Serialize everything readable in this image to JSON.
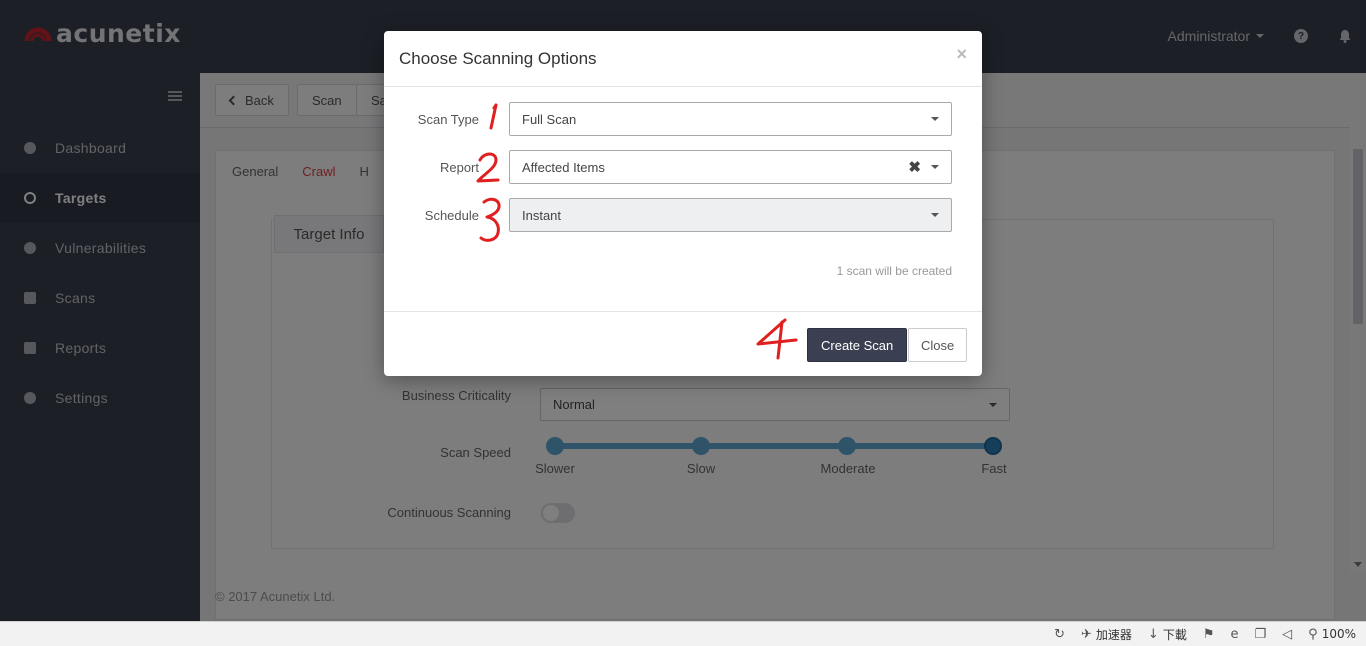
{
  "app": {
    "brand": "acunetix",
    "brand_color": "#c7262e"
  },
  "topbar": {
    "user": "Administrator",
    "help_icon": "question-circle-icon",
    "bell_icon": "bell-icon"
  },
  "sidebar": {
    "items": [
      {
        "label": "Dashboard",
        "icon": "dashboard-icon"
      },
      {
        "label": "Targets",
        "icon": "target-icon",
        "active": true
      },
      {
        "label": "Vulnerabilities",
        "icon": "bug-icon"
      },
      {
        "label": "Scans",
        "icon": "chart-icon"
      },
      {
        "label": "Reports",
        "icon": "document-icon"
      },
      {
        "label": "Settings",
        "icon": "gear-icon"
      }
    ]
  },
  "toolbar": {
    "back": "Back",
    "scan": "Scan",
    "partial": "Sa"
  },
  "tabs": [
    "General",
    "Crawl",
    "H"
  ],
  "target_form": {
    "section_tab": "Target Info",
    "business_criticality_label": "Business Criticality",
    "business_criticality_value": "Normal",
    "scan_speed_label": "Scan Speed",
    "scan_speed_options": [
      "Slower",
      "Slow",
      "Moderate",
      "Fast"
    ],
    "scan_speed_selected": "Fast",
    "continuous_label": "Continuous Scanning"
  },
  "footer": "© 2017 Acunetix Ltd.",
  "modal": {
    "title": "Choose Scanning Options",
    "close_glyph": "×",
    "scan_type_label": "Scan Type",
    "scan_type_value": "Full Scan",
    "report_label": "Report",
    "report_value": "Affected Items",
    "schedule_label": "Schedule",
    "schedule_value": "Instant",
    "scan_count": "1 scan will be created",
    "create_button": "Create Scan",
    "close_button": "Close"
  },
  "annotations": [
    "1",
    "2",
    "3",
    "4"
  ],
  "annotation_color": "#e02020",
  "statusbar": {
    "accelerator": "加速器",
    "download": "下載",
    "zoom": "100%"
  }
}
